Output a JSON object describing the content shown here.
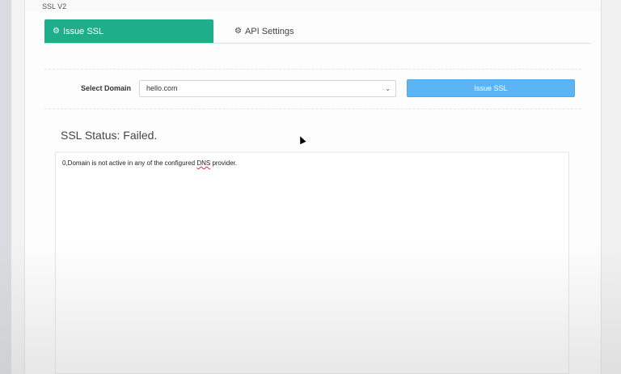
{
  "page": {
    "title": "SSL V2"
  },
  "tabs": [
    {
      "label": "Issue SSL",
      "icon": "gear-icon",
      "active": true
    },
    {
      "label": "API Settings",
      "icon": "gears-icon",
      "active": false
    }
  ],
  "form": {
    "domain_label": "Select Domain",
    "domain_value": "hello.com",
    "issue_button": "Issue SSL"
  },
  "status": {
    "heading": "SSL Status: Failed.",
    "output_prefix": "0,Domain is not active in any of the configured ",
    "output_dns": "DNS",
    "output_suffix": " provider."
  },
  "colors": {
    "accent": "#1fae8a",
    "button": "#5bb4f4"
  }
}
